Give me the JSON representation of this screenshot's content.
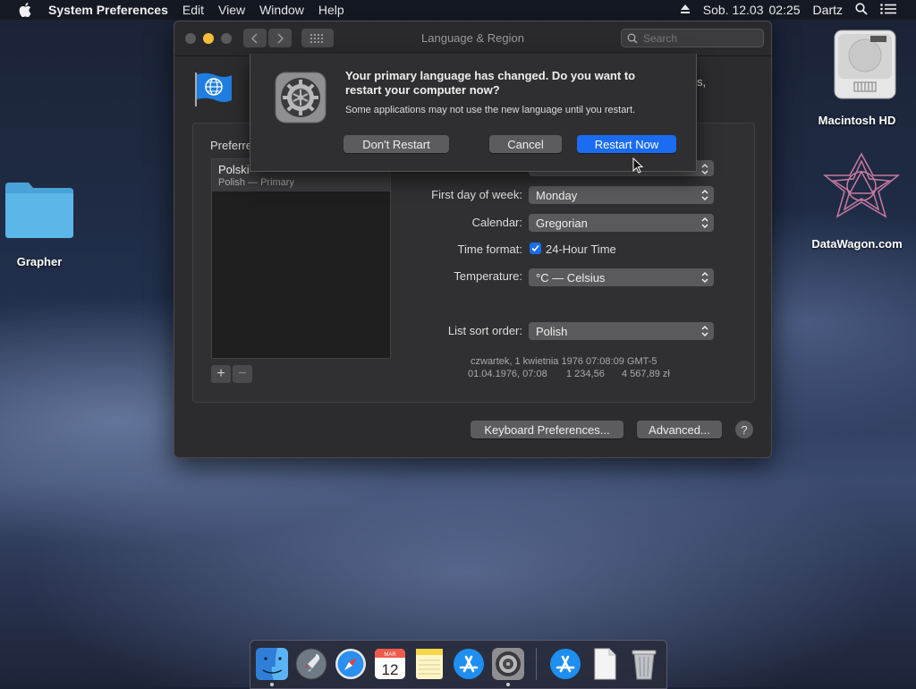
{
  "menubar": {
    "app_name": "System Preferences",
    "items": [
      "Edit",
      "View",
      "Window",
      "Help"
    ],
    "date": "Sob. 12.03",
    "time": "02:25",
    "user": "Dartz"
  },
  "desktop": {
    "icons": [
      {
        "label": "Grapher"
      },
      {
        "label": "Macintosh HD"
      },
      {
        "label": "DataWagon.com"
      }
    ]
  },
  "window": {
    "title": "Language & Region",
    "search_placeholder": "Search",
    "header_partial": "s,",
    "preferred_label": "Preferre",
    "languages": [
      {
        "name": "Polski",
        "sub": "Polish — Primary"
      }
    ],
    "add_symbol": "+",
    "remove_symbol": "−",
    "settings": {
      "first_day_label": "First day of week:",
      "first_day_value": "Monday",
      "calendar_label": "Calendar:",
      "calendar_value": "Gregorian",
      "time_format_label": "Time format:",
      "time_format_value": "24-Hour Time",
      "temperature_label": "Temperature:",
      "temperature_value": "°C — Celsius",
      "sort_label": "List sort order:",
      "sort_value": "Polish"
    },
    "preview_line1": "czwartek, 1 kwietnia 1976 07:08:09 GMT-5",
    "preview_line2_date": "01.04.1976, 07:08",
    "preview_line2_num": "1 234,56",
    "preview_line2_cur": "4 567,89 zł",
    "keyboard_button": "Keyboard Preferences...",
    "advanced_button": "Advanced...",
    "help_symbol": "?"
  },
  "sheet": {
    "heading": "Your primary language has changed. Do you want to restart your computer now?",
    "message": "Some applications may not use the new language until you restart.",
    "dont_restart": "Don't Restart",
    "cancel": "Cancel",
    "restart_now": "Restart Now"
  },
  "dock": {
    "calendar_month": "MAR",
    "calendar_day": "12"
  },
  "colors": {
    "accent": "#1a6cf0",
    "window_bg": "#2c2c2e",
    "close": "#5a5a5c",
    "minimize": "#f6be3b",
    "zoom": "#5a5a5c"
  }
}
